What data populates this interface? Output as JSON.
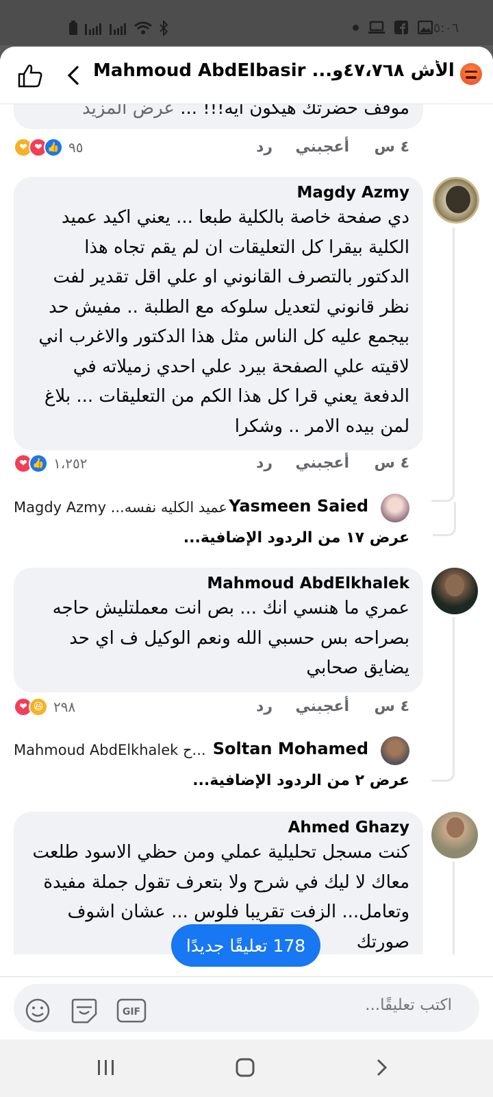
{
  "status_bar": {
    "time": "٥:٠٦"
  },
  "header": {
    "title": "Mahmoud AbdElbasir ...من الأش ٤٧،٧٦٨و",
    "icons": [
      "like-icon",
      "back-icon",
      "angry-reaction-icon"
    ]
  },
  "comments": [
    {
      "partial_text": "موقف حضرتك هيكون ايه!!! ...",
      "see_more": "عرض المزيد",
      "time": "٤ س",
      "like_label": "أعجبني",
      "reply_label": "رد",
      "reaction_count": "٩٥",
      "reactions": [
        "care",
        "love",
        "like"
      ]
    },
    {
      "author": "Magdy Azmy",
      "text": "دي صفحة خاصة بالكلية طبعا ... يعني اكيد عميد الكلية بيقرا كل التعليقات ان لم يقم تجاه هذا الدكتور بالتصرف القانوني او علي اقل تقدير لفت نظر قانوني لتعديل سلوكه مع الطلبة .. مفيش حد بيجمع عليه كل الناس مثل هذا الدكتور والاغرب اني لاقيته علي الصفحة بيرد علي احدي زميلاته في الدفعة يعني قرا كل هذا الكم من التعليقات ... بلاغ لمن بيده الامر .. وشكرا",
      "time": "٤ س",
      "like_label": "أعجبني",
      "reply_label": "رد",
      "reaction_count": "١،٢٥٢",
      "reactions": [
        "love",
        "like"
      ],
      "reply": {
        "author": "Yasmeen Saied",
        "text": "Magdy Azmy  ...عميد الكليه نفسه"
      },
      "more_replies": "عرض ١٧ من الردود الإضافية..."
    },
    {
      "author": "Mahmoud AbdElkhalek",
      "text": "عمري ما هنسي انك ... بص انت معملتليش حاجه بصراحه بس حسبي الله ونعم الوكيل ف اي حد يضايق صحابي",
      "time": "٤ س",
      "like_label": "أعجبني",
      "reply_label": "رد",
      "reaction_count": "٢٩٨",
      "reactions": [
        "love",
        "haha"
      ],
      "reply": {
        "author": "Soltan Mohamed",
        "text": "Mahmoud AbdElkhalek ح..."
      },
      "more_replies": "عرض ٢ من الردود الإضافية..."
    },
    {
      "author": "Ahmed Ghazy",
      "text": "كنت مسجل تحليلية عملي ومن حظي الاسود طلعت معاك لا ليك في شرح ولا بتعرف تقول جملة مفيدة وتعامل... الزفت تقريبا فلوس ... عشان اشوف صورتك"
    }
  ],
  "new_comments_pill": "178 تعليقًا جديدًا",
  "composer": {
    "placeholder": "اكتب تعليقًا...",
    "icons": [
      "emoji-icon",
      "sticker-icon",
      "gif-icon"
    ]
  },
  "nav_bar": {
    "icons": [
      "recent-apps-icon",
      "home-icon",
      "back-nav-icon"
    ]
  },
  "colors": {
    "accent": "#1877f2",
    "bubble": "#f0f2f5",
    "secondary_text": "#65676b"
  }
}
